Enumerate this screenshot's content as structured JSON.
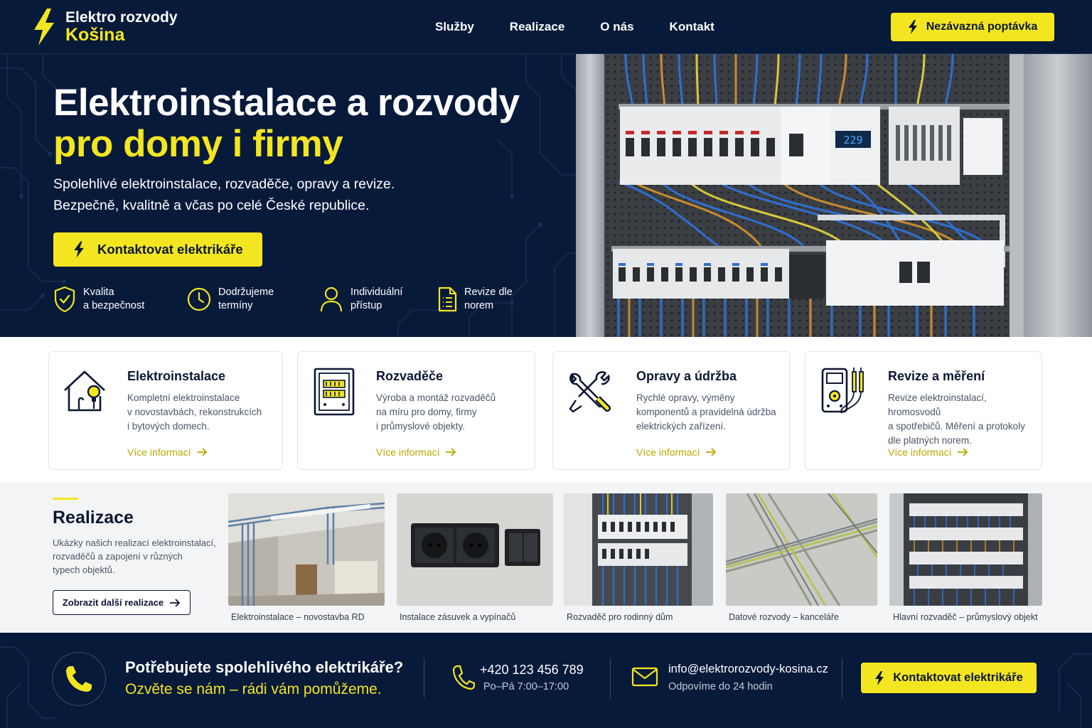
{
  "header": {
    "logo_line1": "Elektro rozvody",
    "logo_line2": "Košina",
    "nav": [
      "Služby",
      "Realizace",
      "O nás",
      "Kontakt"
    ],
    "cta_label": "Nezávazná poptávka"
  },
  "hero": {
    "title_line1": "Elektroinstalace a rozvody",
    "title_line2": "pro domy i firmy",
    "subtitle_line1": "Spolehlivé elektroinstalace, rozvaděče, opravy a revize.",
    "subtitle_line2": "Bezpečně, kvalitně a včas po celé České republice.",
    "cta_label": "Kontaktovat elektrikáře",
    "meter_display": "229",
    "features": [
      {
        "icon": "shield-check-icon",
        "line1": "Kvalita",
        "line2": "a bezpečnost"
      },
      {
        "icon": "clock-icon",
        "line1": "Dodržujeme",
        "line2": "termíny"
      },
      {
        "icon": "user-icon",
        "line1": "Individuální",
        "line2": "přístup"
      },
      {
        "icon": "document-icon",
        "line1": "Revize dle",
        "line2": "norem"
      }
    ]
  },
  "services": [
    {
      "icon": "house-bulb-icon",
      "title": "Elektroinstalace",
      "desc": [
        "Kompletní elektroinstalace",
        "v novostavbách, rekonstrukcích",
        "i bytových domech."
      ],
      "link": "Více informací"
    },
    {
      "icon": "switchboard-icon",
      "title": "Rozvaděče",
      "desc": [
        "Výroba a montáž rozvaděčů",
        "na míru pro domy, firmy",
        "i průmyslové objekty."
      ],
      "link": "Více informací"
    },
    {
      "icon": "tools-icon",
      "title": "Opravy a údržba",
      "desc": [
        "Rychlé opravy, výměny",
        "komponentů a pravidelná údržba",
        "elektrických zařízení."
      ],
      "link": "Více informací"
    },
    {
      "icon": "multimeter-icon",
      "title": "Revize a měření",
      "desc": [
        "Revize elektroinstalací, hromosvodů",
        "a spotřebičů. Měření a protokoly",
        "dle platných norem."
      ],
      "link": "Více informací"
    }
  ],
  "projects": {
    "title": "Realizace",
    "desc": [
      "Ukázky našich realizací elektroinstalací,",
      "rozvaděčů a zapojení v různých",
      "typech objektů."
    ],
    "button": "Zobrazit další realizace",
    "items": [
      "Elektroinstalace – novostavba RD",
      "Instalace zásuvek a vypínačů",
      "Rozvaděč pro rodinný dům",
      "Datové rozvody – kanceláře",
      "Hlavní rozvaděč – průmyslový objekt"
    ]
  },
  "footer": {
    "heading": "Potřebujete spolehlivého elektrikáře?",
    "subheading": "Ozvěte se nám – rádi vám pomůžeme.",
    "phone": "+420 123 456 789",
    "hours": "Po–Pá 7:00–17:00",
    "email": "info@elektrorozvody-kosina.cz",
    "email_note": "Odpovíme do 24 hodin",
    "cta_label": "Kontaktovat elektrikáře"
  },
  "colors": {
    "navy": "#081a3a",
    "accent_yellow": "#f3e620",
    "link_olive": "#b8a700"
  }
}
